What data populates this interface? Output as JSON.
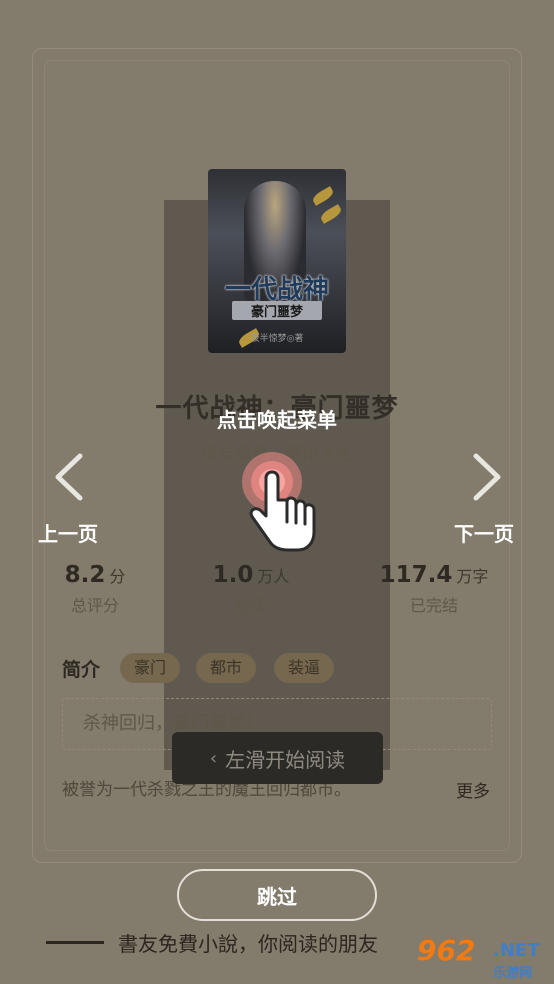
{
  "book": {
    "title": "一代战神：豪门噩梦",
    "meta": "夜半惊梦 | 都市人生",
    "cover": {
      "title_art": "一代战神",
      "subtitle_art": "豪门噩梦",
      "author_art": "夜半惊梦◎著"
    }
  },
  "stats": [
    {
      "value": "8.2",
      "unit": "分",
      "caption": "总评分"
    },
    {
      "value": "1.0",
      "unit": "万人",
      "caption": "在读"
    },
    {
      "value": "117.4",
      "unit": "万字",
      "caption": "已完结"
    }
  ],
  "intro": {
    "label": "简介",
    "tags": [
      "豪门",
      "都市",
      "装逼"
    ],
    "quote": "杀神回归，豪门噩梦！",
    "description": "被誉为一代杀戮之王的魔王回归都市。",
    "more_label": "更多"
  },
  "overlay": {
    "hint": "点击唤起菜单",
    "prev_label": "上一页",
    "next_label": "下一页",
    "swipe_label": "左滑开始阅读"
  },
  "footer": {
    "skip_label": "跳过",
    "slogan": "書友免費小說，你阅读的朋友"
  },
  "watermark": {
    "number": "962",
    "net": ".NET",
    "cn": "乐游网"
  },
  "colors": {
    "accent_hand": "#f08a86",
    "overlay_text": "#ffffff",
    "watermark_orange": "#f07a14",
    "watermark_blue": "#3f7fc9"
  },
  "icons": {
    "prev": "chevron-left-icon",
    "next": "chevron-right-icon",
    "tap": "tap-hand-icon",
    "swipe": "chevron-left-small-icon"
  }
}
